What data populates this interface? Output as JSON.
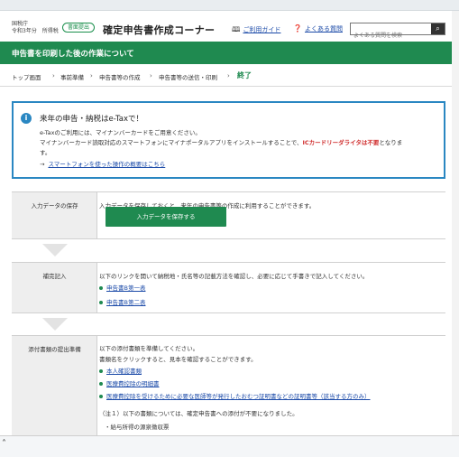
{
  "header": {
    "agency_name": "国税庁",
    "agency_year": "令和3年分",
    "agency_kind": "所得税",
    "badge": "書面提出",
    "site_title": "確定申告書作成コーナー",
    "guide_icon": "book-icon",
    "guide_label": "ご利用ガイド",
    "faq_icon": "question-icon",
    "faq_label": "よくある質問",
    "search_placeholder": "よくある質問を検索",
    "search_icon": "search-icon"
  },
  "banner": {
    "title": "申告書を印刷した後の作業について"
  },
  "breadcrumb": {
    "items": [
      "トップ画面",
      "事前準備",
      "申告書等の作成",
      "申告書等の送信・印刷"
    ],
    "current": "終了",
    "separator": "›"
  },
  "notice": {
    "icon": "info-icon",
    "heading": "来年の申告・納税はe-Taxで！",
    "line1": "e-Taxのご利用には、マイナンバーカードをご用意ください。",
    "line2_pre": "マイナンバーカード読取対応のスマートフォンにマイナポータルアプリをインストールすることで、",
    "line2_red": "ICカードリーダライタは不要",
    "line2_post": "となりま",
    "line3": "す。",
    "link_arrow": "→",
    "link": "スマートフォンを使った操作の概要はこちら"
  },
  "steps": {
    "save": {
      "label": "入力データの保存",
      "description": "入力データを保存しておくと、来年の申告書等の作成に利用することができます。",
      "button": "入力データを保存する"
    },
    "supplement": {
      "label": "補完記入",
      "description": "以下のリンクを開いて納税地・氏名等の記載方法を確認し、必要に応じて手書きで記入してください。",
      "links": [
        "申告書B第一表",
        "申告書B第二表"
      ]
    },
    "attach": {
      "label": "添付書類の提出準備",
      "line1": "以下の添付書類を準備してください。",
      "line2": "書類名をクリックすると、見本を確認することができます。",
      "links": [
        "本人確認書類",
        "医療費控除の明細書",
        "医療費控除を受けるために必要な医師等が発行したおむつ証明書などの証明書等（該当する方のみ）"
      ],
      "note": "（注１）以下の書類については、確定申告書への添付が不要になりました。",
      "partial": "・給与所得の源泉徴収票"
    }
  },
  "colors": {
    "brand_green": "#1f8a50",
    "info_blue": "#2a87c2",
    "alert_red": "#d03030",
    "link_blue": "#1b4aa8"
  }
}
